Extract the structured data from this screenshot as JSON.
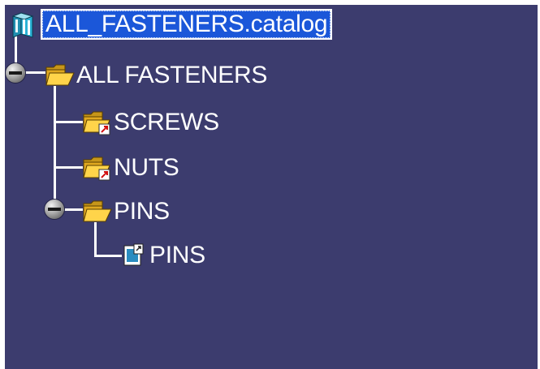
{
  "tree": {
    "root": {
      "label": "ALL_FASTENERS.catalog",
      "icon": "catalog-book-icon",
      "selected": true
    },
    "chapter": {
      "label": "ALL FASTENERS",
      "icon": "open-folder-icon",
      "expanded": true
    },
    "children": [
      {
        "label": "SCREWS",
        "icon": "folder-link-icon"
      },
      {
        "label": "NUTS",
        "icon": "folder-link-icon"
      },
      {
        "label": "PINS",
        "icon": "open-folder-icon",
        "expanded": true
      }
    ],
    "leaf": {
      "label": "PINS",
      "icon": "part-family-icon"
    }
  },
  "colors": {
    "background": "#3c3c6e",
    "selection": "#1b57d9",
    "text": "#ffffff",
    "folder": "#f2c230"
  }
}
